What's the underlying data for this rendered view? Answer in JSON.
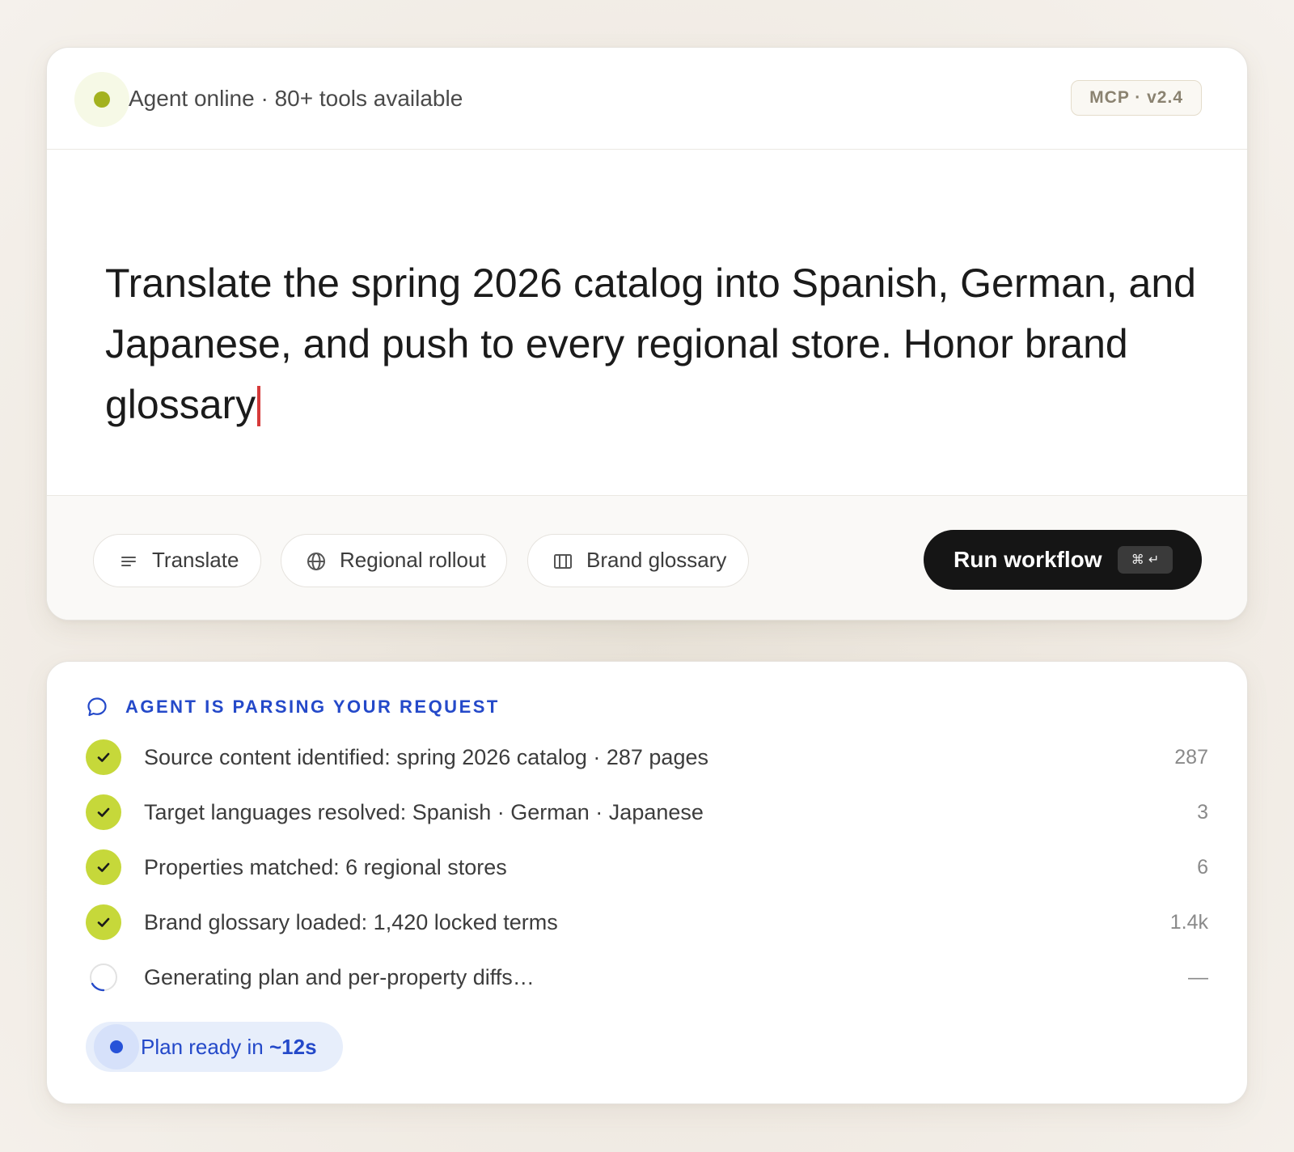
{
  "header": {
    "status": "Agent online",
    "separator": "·",
    "tools": "80+ tools available",
    "version_badge": "MCP · v2.4"
  },
  "prompt": {
    "text": "Translate the spring 2026 catalog into Spanish, German, and Japanese, and push to every regional store. Honor brand glossary"
  },
  "chips": [
    {
      "label": "Translate",
      "icon": "lines-icon"
    },
    {
      "label": "Regional rollout",
      "icon": "globe-icon"
    },
    {
      "label": "Brand glossary",
      "icon": "book-icon"
    }
  ],
  "run": {
    "label": "Run workflow",
    "shortcut": "⌘ ↵"
  },
  "progress": {
    "heading": "AGENT IS PARSING YOUR REQUEST",
    "steps": [
      {
        "text": "Source content identified: spring 2026 catalog · 287 pages",
        "count": "287",
        "state": "done"
      },
      {
        "text": "Target languages resolved: Spanish · German · Japanese",
        "count": "3",
        "state": "done"
      },
      {
        "text": "Properties matched: 6 regional stores",
        "count": "6",
        "state": "done"
      },
      {
        "text": "Brand glossary loaded: 1,420 locked terms",
        "count": "1.4k",
        "state": "done"
      },
      {
        "text": "Generating plan and per-property diffs…",
        "count": "—",
        "state": "in-progress"
      }
    ],
    "eta_prefix": "Plan ready in ",
    "eta_value": "~12s"
  },
  "colors": {
    "status_online": "#a3b21f",
    "step_done": "#c6d83a",
    "accent_blue": "#2449c9",
    "caret": "#d63a3a",
    "run_button": "#151515"
  }
}
